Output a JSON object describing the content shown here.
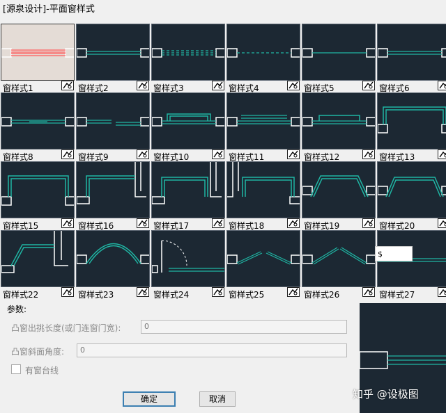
{
  "window": {
    "title": "[源泉设计]-平面窗样式"
  },
  "styles": [
    {
      "label": "窗样式1",
      "kind": "s1"
    },
    {
      "label": "窗样式2",
      "kind": "s2"
    },
    {
      "label": "窗样式3",
      "kind": "s3"
    },
    {
      "label": "窗样式4",
      "kind": "s4"
    },
    {
      "label": "窗样式5",
      "kind": "s5"
    },
    {
      "label": "窗样式6",
      "kind": "s6"
    },
    {
      "label": "窗样式8",
      "kind": "s8"
    },
    {
      "label": "窗样式9",
      "kind": "s9"
    },
    {
      "label": "窗样式10",
      "kind": "s10"
    },
    {
      "label": "窗样式11",
      "kind": "s11"
    },
    {
      "label": "窗样式12",
      "kind": "s12"
    },
    {
      "label": "窗样式13",
      "kind": "s13"
    },
    {
      "label": "窗样式15",
      "kind": "s15"
    },
    {
      "label": "窗样式16",
      "kind": "s16"
    },
    {
      "label": "窗样式17",
      "kind": "s17"
    },
    {
      "label": "窗样式18",
      "kind": "s18"
    },
    {
      "label": "窗样式19",
      "kind": "s19"
    },
    {
      "label": "窗样式20",
      "kind": "s20"
    },
    {
      "label": "窗样式22",
      "kind": "s22"
    },
    {
      "label": "窗样式23",
      "kind": "s23"
    },
    {
      "label": "窗样式24",
      "kind": "s24"
    },
    {
      "label": "窗样式25",
      "kind": "s25"
    },
    {
      "label": "窗样式26",
      "kind": "s26"
    },
    {
      "label": "窗样式27",
      "kind": "s27"
    }
  ],
  "tooltip": {
    "text": "$"
  },
  "params": {
    "title": "参数:",
    "bay_label": "凸窗出挑长度(或门连窗门宽):",
    "bay_value": "0",
    "angle_label": "凸窗斜面角度:",
    "angle_value": "0",
    "sill_label": "有窗台线",
    "sill_checked": false
  },
  "buttons": {
    "ok": "确定",
    "cancel": "取消"
  },
  "watermark": "知乎 @设极图",
  "colors": {
    "thumb_bg": "#1c2833",
    "wall": "#ffffff",
    "window_line": "#1fb5a3",
    "selected_line": "#ff5a5a"
  }
}
